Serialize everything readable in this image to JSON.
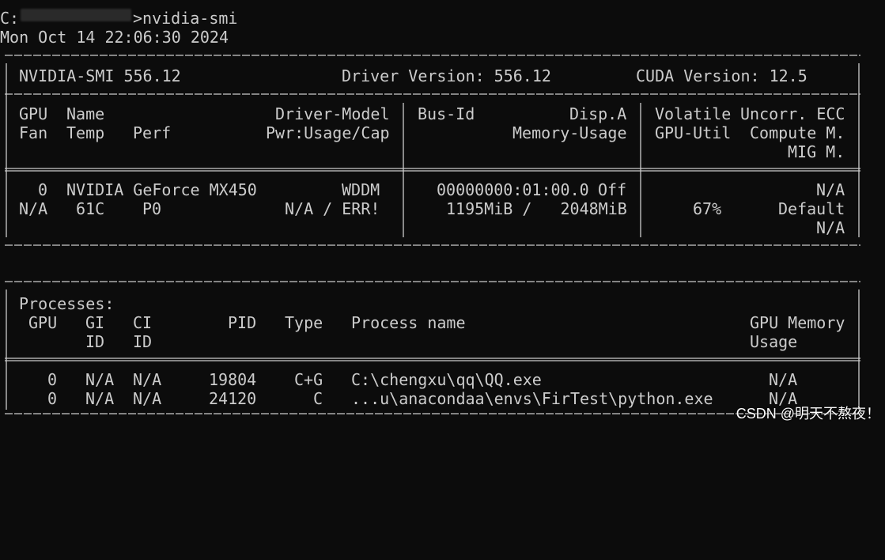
{
  "terminal": {
    "prompt_drive": "C:",
    "prompt_end": ">nvidia-smi",
    "timestamp": "Mon Oct 14 22:06:30 2024"
  },
  "summary": {
    "smi_version": "NVIDIA-SMI 556.12",
    "driver_version": "Driver Version: 556.12",
    "cuda_version": "CUDA Version: 12.5"
  },
  "gpu_headers": {
    "row1": [
      "GPU",
      "Name",
      "Driver-Model",
      "Bus-Id",
      "Disp.A",
      "Volatile",
      "Uncorr. ECC"
    ],
    "row2": [
      "Fan",
      "Temp",
      "Perf",
      "Pwr:Usage/Cap",
      "Memory-Usage",
      "GPU-Util",
      "Compute M."
    ],
    "row3": [
      "MIG M."
    ]
  },
  "gpu": {
    "index": "0",
    "name": "NVIDIA GeForce MX450",
    "driver_model": "WDDM",
    "bus_id": "00000000:01:00.0",
    "disp_a": "Off",
    "ecc": "N/A",
    "fan": "N/A",
    "temp": "61C",
    "perf": "P0",
    "pwr": "N/A / ERR!",
    "memory_usage": "1195MiB /   2048MiB",
    "gpu_util": "67%",
    "compute_mode": "Default",
    "mig_mode": "N/A"
  },
  "processes": {
    "title": "Processes:",
    "headers_row1": [
      "GPU",
      "GI",
      "CI",
      "PID",
      "Type",
      "Process name",
      "GPU Memory"
    ],
    "headers_row2": [
      "ID",
      "ID",
      "Usage"
    ],
    "rows": [
      {
        "gpu": "0",
        "gi": "N/A",
        "ci": "N/A",
        "pid": "19804",
        "type": "C+G",
        "name": "C:\\chengxu\\qq\\QQ.exe",
        "mem": "N/A"
      },
      {
        "gpu": "0",
        "gi": "N/A",
        "ci": "N/A",
        "pid": "24120",
        "type": "C",
        "name": "...u\\anacondaa\\envs\\FirTest\\python.exe",
        "mem": "N/A"
      }
    ]
  },
  "watermark": "CSDN @明天不熬夜！"
}
